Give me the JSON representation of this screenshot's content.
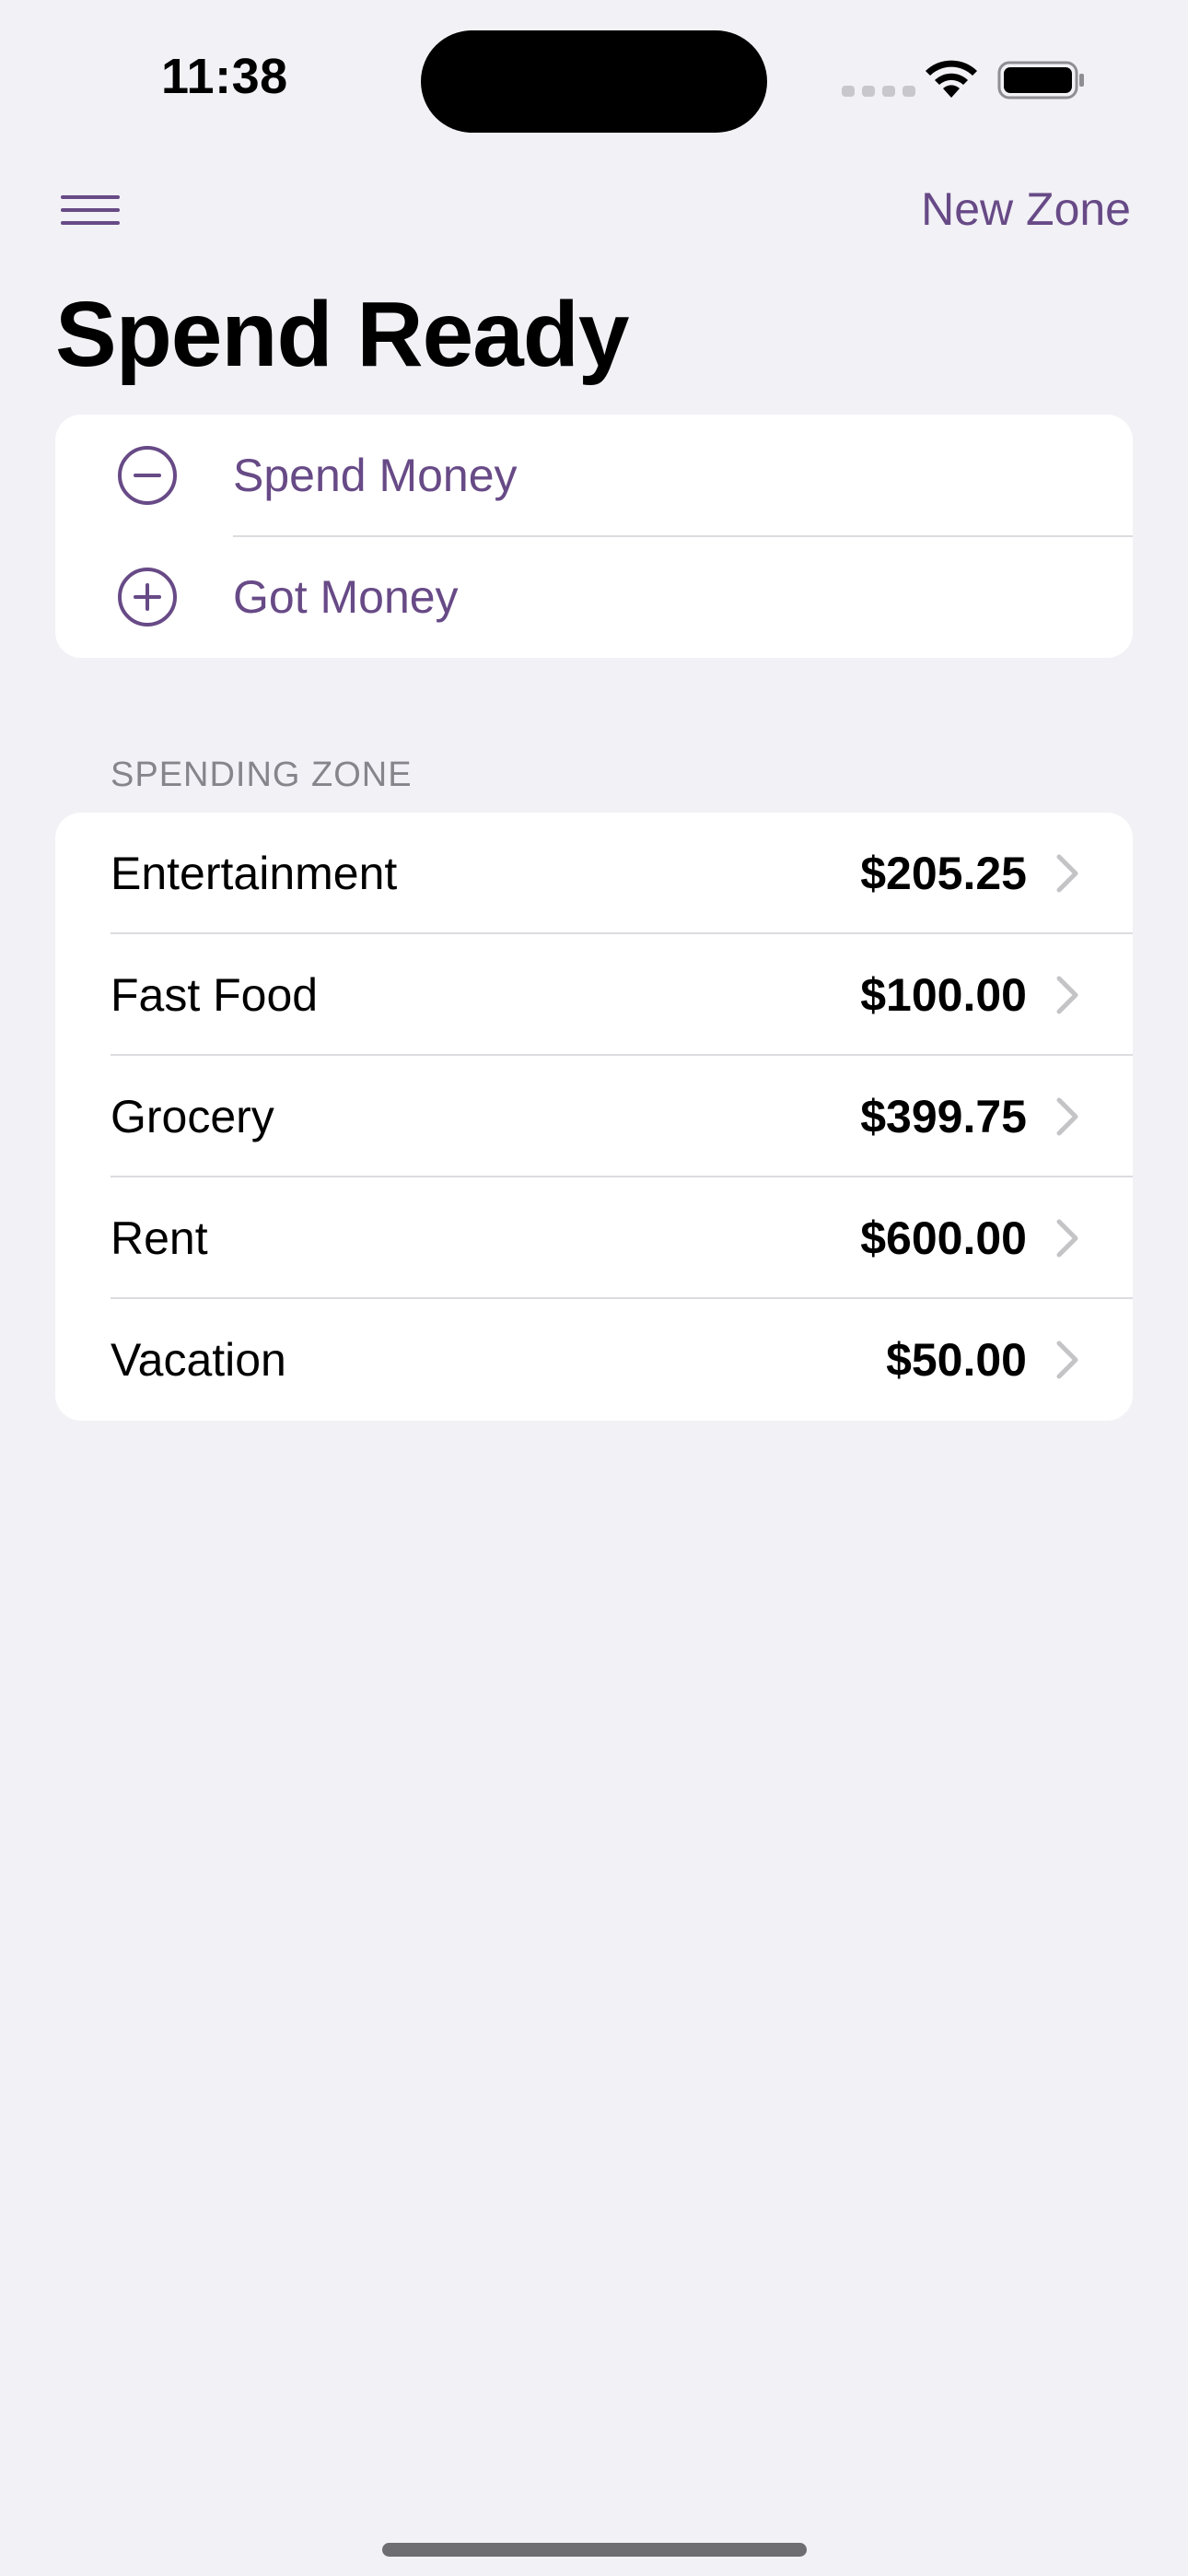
{
  "status_bar": {
    "time": "11:38"
  },
  "nav": {
    "menu_icon": "hamburger-menu-icon",
    "new_zone_label": "New Zone"
  },
  "page": {
    "title": "Spend Ready"
  },
  "actions": [
    {
      "label": "Spend Money",
      "icon": "minus-circle-icon"
    },
    {
      "label": "Got Money",
      "icon": "plus-circle-icon"
    }
  ],
  "spending_zone": {
    "header": "SPENDING ZONE",
    "items": [
      {
        "name": "Entertainment",
        "amount": "$205.25"
      },
      {
        "name": "Fast Food",
        "amount": "$100.00"
      },
      {
        "name": "Grocery",
        "amount": "$399.75"
      },
      {
        "name": "Rent",
        "amount": "$600.00"
      },
      {
        "name": "Vacation",
        "amount": "$50.00"
      }
    ]
  },
  "colors": {
    "accent": "#674a86",
    "background": "#f2f1f6",
    "card": "#ffffff",
    "secondary_text": "#85858b",
    "chevron": "#c4c4c7"
  }
}
